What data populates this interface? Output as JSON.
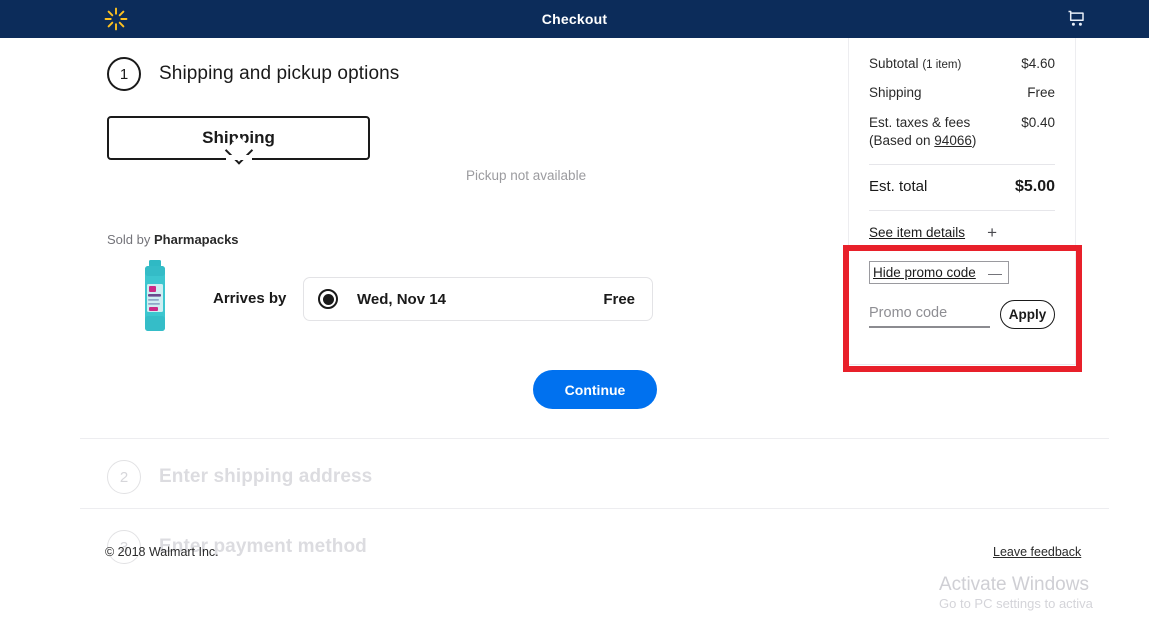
{
  "header": {
    "title": "Checkout",
    "logo_icon": "walmart-spark-icon",
    "cart_icon": "shopping-cart-icon",
    "bg_color": "#0c2c5a",
    "logo_color": "#ffc220"
  },
  "steps": [
    {
      "number": "1",
      "title": "Shipping and pickup options",
      "state": "active"
    },
    {
      "number": "2",
      "title": "Enter shipping address",
      "state": "disabled"
    },
    {
      "number": "3",
      "title": "Enter payment method",
      "state": "disabled"
    }
  ],
  "fulfillment": {
    "tab_shipping_label": "Shipping",
    "pickup_unavailable_label": "Pickup not available",
    "sold_by_prefix": "Sold by ",
    "seller_name": "Pharmapacks",
    "product_image_alt": "suave-dry-shampoo-bottle",
    "arrives_by_label": "Arrives by",
    "delivery_date": "Wed, Nov 14",
    "delivery_price": "Free",
    "delivery_selected": true,
    "continue_label": "Continue",
    "continue_color": "#0071ef"
  },
  "summary": {
    "subtotal_label": "Subtotal",
    "subtotal_qty": "(1 item)",
    "subtotal_value": "$4.60",
    "shipping_label": "Shipping",
    "shipping_value": "Free",
    "taxes_label": "Est. taxes & fees",
    "taxes_based_prefix": "(Based on ",
    "taxes_zip": "94066",
    "taxes_based_suffix": ")",
    "taxes_value": "$0.40",
    "total_label": "Est. total",
    "total_value": "$5.00",
    "see_item_details_label": "See item details",
    "see_item_details_icon": "plus-icon"
  },
  "promo": {
    "hide_promo_label": "Hide promo code",
    "collapse_icon": "minus-icon",
    "input_value": "",
    "input_placeholder": "Promo code",
    "apply_label": "Apply",
    "highlight_color": "#e8202a"
  },
  "footer": {
    "copyright": "© 2018 Walmart Inc.",
    "leave_feedback_label": "Leave feedback"
  },
  "watermark": {
    "title": "Activate Windows",
    "subtitle": "Go to PC settings to activa"
  }
}
